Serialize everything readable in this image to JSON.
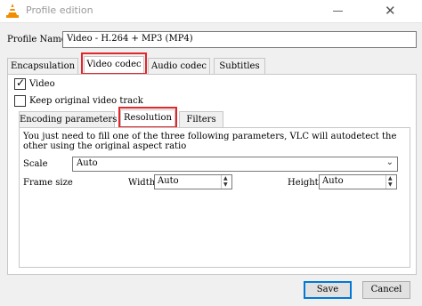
{
  "window": {
    "title": "Profile edition",
    "icon": "vlc-cone-icon",
    "minimize": "minimize-button",
    "close": "close-button"
  },
  "profile": {
    "label": "Profile Name",
    "value": "Video - H.264 + MP3 (MP4)"
  },
  "tabs": [
    {
      "label": "Encapsulation",
      "active": false
    },
    {
      "label": "Video codec",
      "active": true,
      "highlighted": true
    },
    {
      "label": "Audio codec",
      "active": false
    },
    {
      "label": "Subtitles",
      "active": false
    }
  ],
  "video": {
    "video_checkbox": {
      "label": "Video",
      "checked": true
    },
    "keep_original": {
      "label": "Keep original video track",
      "checked": false
    }
  },
  "subtabs": [
    {
      "label": "Encoding parameters",
      "active": false
    },
    {
      "label": "Resolution",
      "active": true,
      "highlighted": true
    },
    {
      "label": "Filters",
      "active": false
    }
  ],
  "resolution": {
    "hint_line1": "You just need to fill one of the three following parameters, VLC will autodetect the",
    "hint_line2": "other using the original aspect ratio",
    "scale_label": "Scale",
    "scale_value": "Auto",
    "frame_size_label": "Frame size",
    "width_label": "Width",
    "width_value": "Auto",
    "height_label": "Height",
    "height_value": "Auto"
  },
  "buttons": {
    "save": "Save",
    "cancel": "Cancel"
  },
  "colors": {
    "highlight": "#e2272c",
    "accent": "#0078d7",
    "vlc_orange": "#f28c00"
  }
}
